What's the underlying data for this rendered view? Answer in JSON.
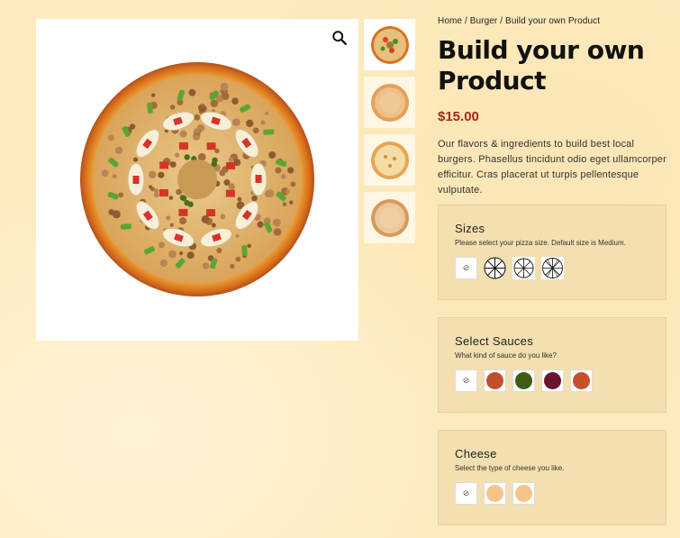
{
  "breadcrumb": {
    "home": "Home",
    "sep": "/",
    "category": "Burger",
    "current": "Build your own Product"
  },
  "product": {
    "title": "Build your own Product",
    "price": "$15.00",
    "description": "Our flavors & ingredients to build best local burgers. Phasellus tincidunt odio eget ullamcorper efficitur. Cras placerat ut turpis pellentesque vulputate."
  },
  "icons": {
    "zoom": "search-icon",
    "none": "⊘"
  },
  "options": {
    "sizes": {
      "title": "Sizes",
      "subtitle": "Please select your pizza size. Default size is Medium."
    },
    "sauces": {
      "title": "Select Sauces",
      "subtitle": "What kind of sauce do you like?",
      "colors": [
        "#c24e2c",
        "#3f5d17",
        "#6a1330",
        "#c4502c"
      ]
    },
    "cheese": {
      "title": "Cheese",
      "subtitle": "Select the type of cheese you like.",
      "colors": [
        "#f6c48a",
        "#f6c48a"
      ]
    }
  },
  "colors": {
    "price": "#a3281a",
    "background": "#fdebbe",
    "panel": "#f3dfb0"
  }
}
